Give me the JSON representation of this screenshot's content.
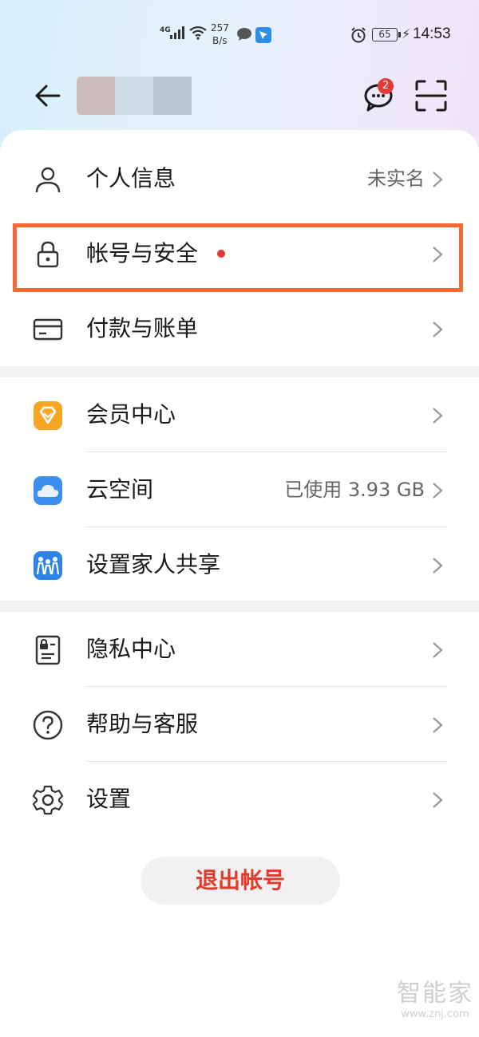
{
  "status_bar": {
    "network": "4G",
    "speed_value": "257",
    "speed_unit": "B/s",
    "battery": "65",
    "time": "14:53"
  },
  "header": {
    "chat_badge": "2",
    "icons": [
      "back-arrow-icon",
      "chat-bubble-icon",
      "scan-icon"
    ]
  },
  "menu_group_1": [
    {
      "label": "个人信息",
      "value": "未实名",
      "icon": "person-icon"
    },
    {
      "label": "帐号与安全",
      "value": "",
      "icon": "lock-icon",
      "red_dot": true
    },
    {
      "label": "付款与账单",
      "value": "",
      "icon": "card-icon"
    }
  ],
  "menu_group_2": [
    {
      "label": "会员中心",
      "value": "",
      "icon": "membership-diamond-icon"
    },
    {
      "label": "云空间",
      "value": "已使用 3.93 GB",
      "icon": "cloud-icon"
    },
    {
      "label": "设置家人共享",
      "value": "",
      "icon": "family-share-icon"
    }
  ],
  "menu_group_3": [
    {
      "label": "隐私中心",
      "value": "",
      "icon": "privacy-icon"
    },
    {
      "label": "帮助与客服",
      "value": "",
      "icon": "help-icon"
    },
    {
      "label": "设置",
      "value": "",
      "icon": "gear-icon"
    }
  ],
  "logout_label": "退出帐号",
  "watermark": {
    "brand": "智能家",
    "url": "www.znj.com"
  },
  "colors": {
    "highlight_border": "#f46a35",
    "logout_text": "#e33a2c",
    "badge_red": "#e53935",
    "membership_orange": "#f6a623",
    "cloud_blue": "#3c8ff0"
  }
}
